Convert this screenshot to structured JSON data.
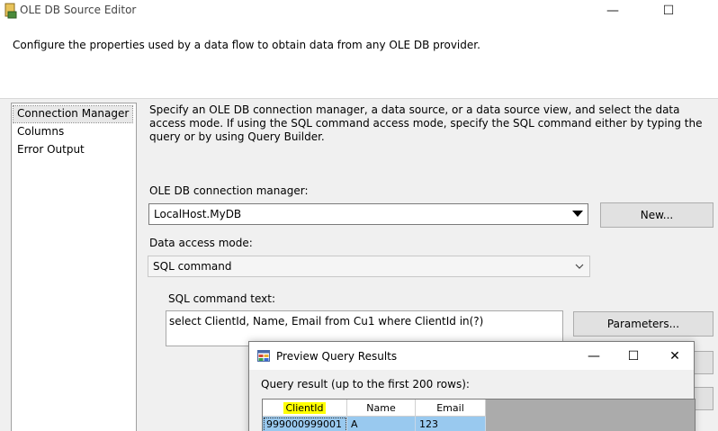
{
  "window": {
    "title": "OLE DB Source Editor",
    "icon": "ssis-source-icon",
    "minimize_glyph": "—",
    "maximize_glyph": "☐"
  },
  "header": {
    "description": "Configure the properties used by a data flow to obtain data from any OLE DB provider."
  },
  "nav": {
    "items": [
      {
        "label": "Connection Manager",
        "selected": true
      },
      {
        "label": "Columns",
        "selected": false
      },
      {
        "label": "Error Output",
        "selected": false
      }
    ]
  },
  "content": {
    "description": "Specify an OLE DB connection manager, a data source, or a data source view, and select the data access mode. If using the SQL command access mode, specify the SQL command either by typing the query or by using Query Builder.",
    "connection_label": "OLE DB connection manager:",
    "connection_value": "LocalHost.MyDB",
    "new_button": "New...",
    "access_mode_label": "Data access mode:",
    "access_mode_value": "SQL command",
    "sql_label": "SQL command text:",
    "sql_text": "select ClientId, Name, Email from Cu1 where ClientId in(?)",
    "parameters_button": "Parameters..."
  },
  "preview": {
    "title": "Preview Query Results",
    "minimize_glyph": "—",
    "maximize_glyph": "☐",
    "close_glyph": "✕",
    "result_label": "Query result (up to the first 200 rows):",
    "columns": [
      "ClientId",
      "Name",
      "Email"
    ],
    "rows": [
      [
        "999000999001",
        "A",
        "123"
      ]
    ],
    "highlight_color": "#ffff00",
    "selection_color": "#99c9ef"
  }
}
